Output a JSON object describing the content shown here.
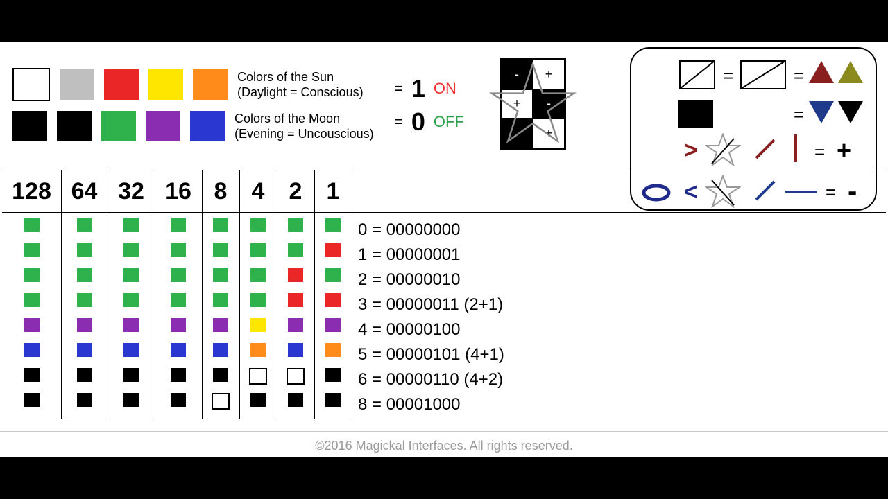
{
  "sun": {
    "title": "Colors of the Sun",
    "sub": "(Daylight = Conscious)"
  },
  "moon": {
    "title": "Colors of the Moon",
    "sub": "(Evening = Uncouscious)"
  },
  "onoff": {
    "eq": "=",
    "one": "1",
    "zero": "0",
    "on": "ON",
    "off": "OFF"
  },
  "checker": {
    "minus": "-",
    "plus": "+"
  },
  "legend": {
    "eq": "=",
    "plus": "+",
    "minus": "-",
    "gt": ">",
    "lt": "<"
  },
  "bits": [
    "128",
    "64",
    "32",
    "16",
    "8",
    "4",
    "2",
    "1"
  ],
  "colors": {
    "green": "#2fb24c",
    "red": "#ea2626",
    "yellow": "#ffe600",
    "orange": "#ff8c1a",
    "purple": "#8a2db0",
    "blue": "#2a37d1",
    "black": "#000",
    "white": "outline"
  },
  "grid_rows": [
    [
      "green",
      "green",
      "green",
      "green",
      "green",
      "green",
      "green",
      "green"
    ],
    [
      "green",
      "green",
      "green",
      "green",
      "green",
      "green",
      "green",
      "red"
    ],
    [
      "green",
      "green",
      "green",
      "green",
      "green",
      "green",
      "red",
      "green"
    ],
    [
      "green",
      "green",
      "green",
      "green",
      "green",
      "green",
      "red",
      "red"
    ],
    [
      "purple",
      "purple",
      "purple",
      "purple",
      "purple",
      "yellow",
      "purple",
      "purple"
    ],
    [
      "blue",
      "blue",
      "blue",
      "blue",
      "blue",
      "orange",
      "blue",
      "orange"
    ],
    [
      "black",
      "black",
      "black",
      "black",
      "black",
      "white",
      "white",
      "black"
    ],
    [
      "black",
      "black",
      "black",
      "black",
      "white",
      "black",
      "black",
      "black"
    ]
  ],
  "equations": [
    "0 = 00000000",
    "1 = 00000001",
    "2 = 00000010",
    "3 = 00000011  (2+1)",
    "4 = 00000100",
    "5 = 00000101  (4+1)",
    "6 = 00000110  (4+2)",
    "8 = 00001000"
  ],
  "footer": "©2016 Magickal Interfaces.  All rights reserved.",
  "chart_data": {
    "type": "table",
    "description": "8-bit place-value table mapping colour-coded on/off cells to binary values",
    "bit_values": [
      128,
      64,
      32,
      16,
      8,
      4,
      2,
      1
    ],
    "rows": [
      {
        "value": 0,
        "binary": "00000000",
        "note": ""
      },
      {
        "value": 1,
        "binary": "00000001",
        "note": ""
      },
      {
        "value": 2,
        "binary": "00000010",
        "note": ""
      },
      {
        "value": 3,
        "binary": "00000011",
        "note": "2+1"
      },
      {
        "value": 4,
        "binary": "00000100",
        "note": ""
      },
      {
        "value": 5,
        "binary": "00000101",
        "note": "4+1"
      },
      {
        "value": 6,
        "binary": "00000110",
        "note": "4+2"
      },
      {
        "value": 8,
        "binary": "00001000",
        "note": ""
      }
    ]
  }
}
